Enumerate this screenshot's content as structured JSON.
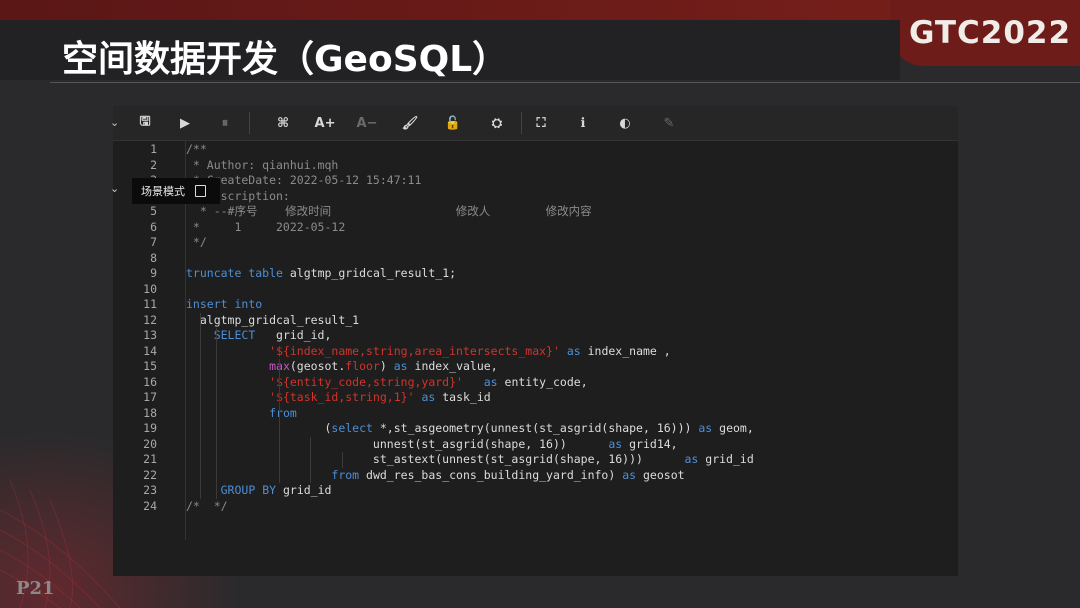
{
  "slide": {
    "title": "空间数据开发（GeoSQL）",
    "logo": "GTC2022",
    "page": "P21"
  },
  "toolbar": {
    "buttons": [
      {
        "name": "save-icon",
        "glyph": "🖫"
      },
      {
        "name": "run-icon",
        "glyph": "▶"
      },
      {
        "name": "stop-icon",
        "glyph": "⏸"
      },
      {
        "name": "format-icon",
        "glyph": "⌘"
      },
      {
        "name": "font-increase-icon",
        "glyph": "A+"
      },
      {
        "name": "font-decrease-icon",
        "glyph": "A−"
      },
      {
        "name": "brush-icon",
        "glyph": "🖌"
      },
      {
        "name": "lock-icon",
        "glyph": "🔓"
      },
      {
        "name": "plugin-icon",
        "glyph": "⛭"
      },
      {
        "name": "fullscreen-icon",
        "glyph": "⛶"
      },
      {
        "name": "info-icon",
        "glyph": "ℹ"
      },
      {
        "name": "theme-icon",
        "glyph": "◐"
      },
      {
        "name": "edit-icon",
        "glyph": "✎"
      }
    ]
  },
  "tooltip": {
    "label": "场景模式"
  },
  "code": {
    "lines": [
      {
        "n": "1",
        "t": "/**"
      },
      {
        "n": "2",
        "t": " * Author: qianhui.mqh"
      },
      {
        "n": "3",
        "t": " * CreateDate: 2022-05-12 15:47:11"
      },
      {
        "n": "4",
        "t": " * Description:"
      },
      {
        "n": "5",
        "t": "  * --#序号    修改时间                  修改人        修改内容"
      },
      {
        "n": "6",
        "t": " *     1     2022-05-12"
      },
      {
        "n": "7",
        "t": " */"
      },
      {
        "n": "8",
        "t": ""
      },
      {
        "n": "9",
        "t": "truncate table algtmp_gridcal_result_1;"
      },
      {
        "n": "10",
        "t": ""
      },
      {
        "n": "11",
        "t": "insert into"
      },
      {
        "n": "12",
        "t": "  algtmp_gridcal_result_1"
      },
      {
        "n": "13",
        "t": "    SELECT   grid_id,"
      },
      {
        "n": "14",
        "t": "            '${index_name,string,area_intersects_max}' as index_name ,"
      },
      {
        "n": "15",
        "t": "            max(geosot.floor) as index_value,"
      },
      {
        "n": "16",
        "t": "            '${entity_code,string,yard}'   as entity_code,"
      },
      {
        "n": "17",
        "t": "            '${task_id,string,1}' as task_id"
      },
      {
        "n": "18",
        "t": "            from"
      },
      {
        "n": "19",
        "t": "                    (select *,st_asgeometry(unnest(st_asgrid(shape, 16))) as geom,"
      },
      {
        "n": "20",
        "t": "                           unnest(st_asgrid(shape, 16))      as grid14,"
      },
      {
        "n": "21",
        "t": "                           st_astext(unnest(st_asgrid(shape, 16)))      as grid_id"
      },
      {
        "n": "22",
        "t": "                     from dwd_res_bas_cons_building_yard_info) as geosot"
      },
      {
        "n": "23",
        "t": "     GROUP BY grid_id"
      },
      {
        "n": "24",
        "t": "/*  */"
      }
    ]
  }
}
